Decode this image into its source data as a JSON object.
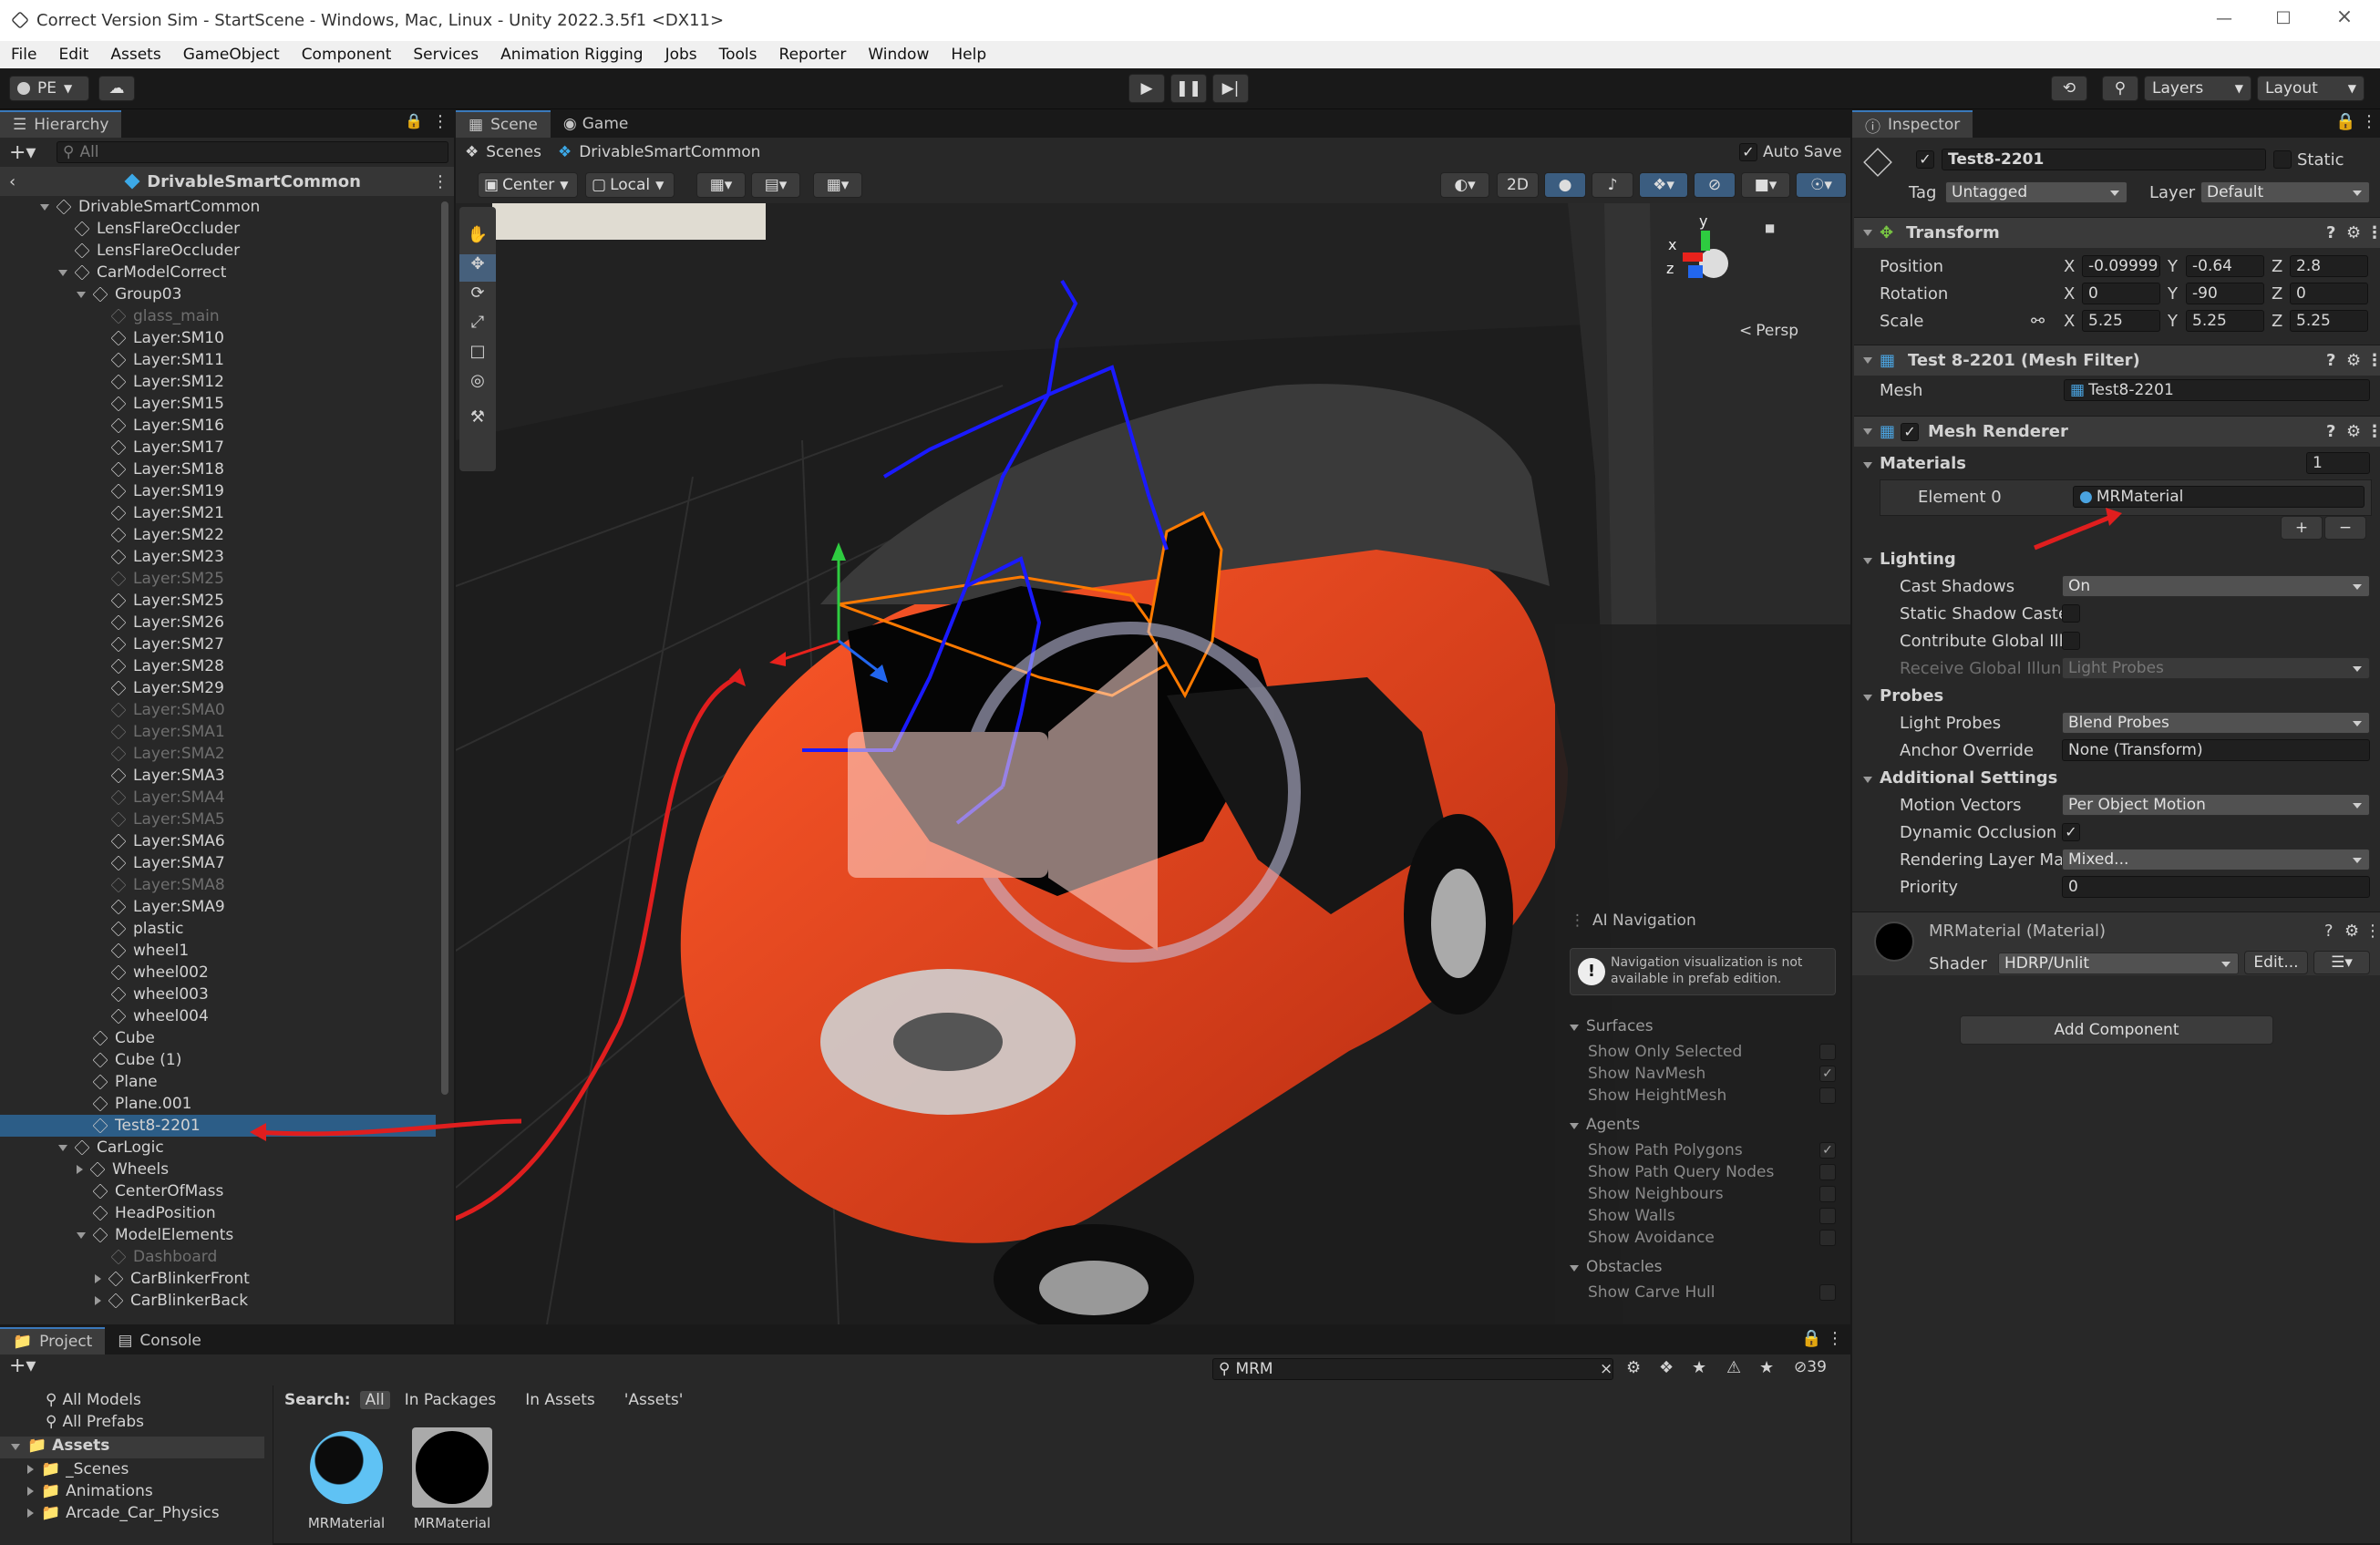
{
  "window": {
    "title": "Correct Version Sim - StartScene - Windows, Mac, Linux - Unity 2022.3.5f1 <DX11>"
  },
  "menu": [
    "File",
    "Edit",
    "Assets",
    "GameObject",
    "Component",
    "Services",
    "Animation Rigging",
    "Jobs",
    "Tools",
    "Reporter",
    "Window",
    "Help"
  ],
  "toolbar": {
    "account": "PE",
    "layers": "Layers",
    "layout": "Layout"
  },
  "hierarchy": {
    "tab": "Hierarchy",
    "search_placeholder": "All",
    "scene": "DrivableSmartCommon",
    "rows": [
      {
        "label": "DrivableSmartCommon",
        "indent": 1,
        "exp": "d",
        "dim": false
      },
      {
        "label": "LensFlareOccluder",
        "indent": 2,
        "exp": "",
        "dim": false
      },
      {
        "label": "LensFlareOccluder",
        "indent": 2,
        "exp": "",
        "dim": false
      },
      {
        "label": "CarModelCorrect",
        "indent": 2,
        "exp": "d",
        "dim": false
      },
      {
        "label": "Group03",
        "indent": 3,
        "exp": "d",
        "dim": false
      },
      {
        "label": "glass_main",
        "indent": 4,
        "exp": "",
        "dim": true
      },
      {
        "label": "Layer:SM10",
        "indent": 4,
        "exp": "",
        "dim": false
      },
      {
        "label": "Layer:SM11",
        "indent": 4,
        "exp": "",
        "dim": false
      },
      {
        "label": "Layer:SM12",
        "indent": 4,
        "exp": "",
        "dim": false
      },
      {
        "label": "Layer:SM15",
        "indent": 4,
        "exp": "",
        "dim": false
      },
      {
        "label": "Layer:SM16",
        "indent": 4,
        "exp": "",
        "dim": false
      },
      {
        "label": "Layer:SM17",
        "indent": 4,
        "exp": "",
        "dim": false
      },
      {
        "label": "Layer:SM18",
        "indent": 4,
        "exp": "",
        "dim": false
      },
      {
        "label": "Layer:SM19",
        "indent": 4,
        "exp": "",
        "dim": false
      },
      {
        "label": "Layer:SM21",
        "indent": 4,
        "exp": "",
        "dim": false
      },
      {
        "label": "Layer:SM22",
        "indent": 4,
        "exp": "",
        "dim": false
      },
      {
        "label": "Layer:SM23",
        "indent": 4,
        "exp": "",
        "dim": false
      },
      {
        "label": "Layer:SM25",
        "indent": 4,
        "exp": "",
        "dim": true
      },
      {
        "label": "Layer:SM25",
        "indent": 4,
        "exp": "",
        "dim": false
      },
      {
        "label": "Layer:SM26",
        "indent": 4,
        "exp": "",
        "dim": false
      },
      {
        "label": "Layer:SM27",
        "indent": 4,
        "exp": "",
        "dim": false
      },
      {
        "label": "Layer:SM28",
        "indent": 4,
        "exp": "",
        "dim": false
      },
      {
        "label": "Layer:SM29",
        "indent": 4,
        "exp": "",
        "dim": false
      },
      {
        "label": "Layer:SMA0",
        "indent": 4,
        "exp": "",
        "dim": true
      },
      {
        "label": "Layer:SMA1",
        "indent": 4,
        "exp": "",
        "dim": true
      },
      {
        "label": "Layer:SMA2",
        "indent": 4,
        "exp": "",
        "dim": true
      },
      {
        "label": "Layer:SMA3",
        "indent": 4,
        "exp": "",
        "dim": false
      },
      {
        "label": "Layer:SMA4",
        "indent": 4,
        "exp": "",
        "dim": true
      },
      {
        "label": "Layer:SMA5",
        "indent": 4,
        "exp": "",
        "dim": true
      },
      {
        "label": "Layer:SMA6",
        "indent": 4,
        "exp": "",
        "dim": false
      },
      {
        "label": "Layer:SMA7",
        "indent": 4,
        "exp": "",
        "dim": false
      },
      {
        "label": "Layer:SMA8",
        "indent": 4,
        "exp": "",
        "dim": true
      },
      {
        "label": "Layer:SMA9",
        "indent": 4,
        "exp": "",
        "dim": false
      },
      {
        "label": "plastic",
        "indent": 4,
        "exp": "",
        "dim": false
      },
      {
        "label": "wheel1",
        "indent": 4,
        "exp": "",
        "dim": false
      },
      {
        "label": "wheel002",
        "indent": 4,
        "exp": "",
        "dim": false
      },
      {
        "label": "wheel003",
        "indent": 4,
        "exp": "",
        "dim": false
      },
      {
        "label": "wheel004",
        "indent": 4,
        "exp": "",
        "dim": false
      },
      {
        "label": "Cube",
        "indent": 3,
        "exp": "",
        "dim": false
      },
      {
        "label": "Cube (1)",
        "indent": 3,
        "exp": "",
        "dim": false
      },
      {
        "label": "Plane",
        "indent": 3,
        "exp": "",
        "dim": false
      },
      {
        "label": "Plane.001",
        "indent": 3,
        "exp": "",
        "dim": false
      },
      {
        "label": "Test8-2201",
        "indent": 3,
        "exp": "",
        "dim": false,
        "sel": true
      },
      {
        "label": "CarLogic",
        "indent": 2,
        "exp": "d",
        "dim": false
      },
      {
        "label": "Wheels",
        "indent": 3,
        "exp": "r",
        "dim": false
      },
      {
        "label": "CenterOfMass",
        "indent": 3,
        "exp": "",
        "dim": false
      },
      {
        "label": "HeadPosition",
        "indent": 3,
        "exp": "",
        "dim": false
      },
      {
        "label": "ModelElements",
        "indent": 3,
        "exp": "d",
        "dim": false
      },
      {
        "label": "Dashboard",
        "indent": 4,
        "exp": "",
        "dim": true
      },
      {
        "label": "CarBlinkerFront",
        "indent": 4,
        "exp": "r",
        "dim": false
      },
      {
        "label": "CarBlinkerBack",
        "indent": 4,
        "exp": "r",
        "dim": false
      }
    ]
  },
  "scene": {
    "tab_scene": "Scene",
    "tab_game": "Game",
    "breadcrumb_root": "Scenes",
    "breadcrumb_prefab": "DrivableSmartCommon",
    "auto_save": "Auto Save",
    "pivot": "Center",
    "space": "Local",
    "mode_2d": "2D",
    "persp": "Persp",
    "gizmo_axes": {
      "y": "y",
      "x": "x",
      "z": "z"
    }
  },
  "ai_nav": {
    "title": "AI Navigation",
    "notice": "Navigation visualization is not available in prefab edition.",
    "surfaces": "Surfaces",
    "surface_items": [
      {
        "label": "Show Only Selected",
        "checked": false
      },
      {
        "label": "Show NavMesh",
        "checked": true
      },
      {
        "label": "Show HeightMesh",
        "checked": false
      }
    ],
    "agents": "Agents",
    "agent_items": [
      {
        "label": "Show Path Polygons",
        "checked": true
      },
      {
        "label": "Show Path Query Nodes",
        "checked": false
      },
      {
        "label": "Show Neighbours",
        "checked": false
      },
      {
        "label": "Show Walls",
        "checked": false
      },
      {
        "label": "Show Avoidance",
        "checked": false
      }
    ],
    "obstacles": "Obstacles",
    "obstacle_items": [
      {
        "label": "Show Carve Hull",
        "checked": false
      }
    ]
  },
  "inspector": {
    "tab": "Inspector",
    "object_name": "Test8-2201",
    "static": "Static",
    "tag_label": "Tag",
    "tag": "Untagged",
    "layer_label": "Layer",
    "layer": "Default",
    "transform": {
      "title": "Transform",
      "position": {
        "label": "Position",
        "x": "-0.09999",
        "y": "-0.64",
        "z": "2.8"
      },
      "rotation": {
        "label": "Rotation",
        "x": "0",
        "y": "-90",
        "z": "0"
      },
      "scale": {
        "label": "Scale",
        "x": "5.25",
        "y": "5.25",
        "z": "5.25"
      }
    },
    "mesh_filter": {
      "title": "Test 8-2201 (Mesh Filter)",
      "mesh_label": "Mesh",
      "mesh": "Test8-2201"
    },
    "mesh_renderer": {
      "title": "Mesh Renderer",
      "materials_label": "Materials",
      "materials_count": "1",
      "element_label": "Element 0",
      "element_value": "MRMaterial",
      "lighting": "Lighting",
      "cast_shadows_label": "Cast Shadows",
      "cast_shadows": "On",
      "static_shadow_label": "Static Shadow Caste",
      "contribute_gi_label": "Contribute Global Ill",
      "receive_gi_label": "Receive Global Illun",
      "receive_gi": "Light Probes",
      "probes": "Probes",
      "light_probes_label": "Light Probes",
      "light_probes": "Blend Probes",
      "anchor_label": "Anchor Override",
      "anchor": "None (Transform)",
      "additional": "Additional Settings",
      "motion_label": "Motion Vectors",
      "motion": "Per Object Motion",
      "dyn_occ_label": "Dynamic Occlusion",
      "render_layer_label": "Rendering Layer Ma",
      "render_layer": "Mixed...",
      "priority_label": "Priority",
      "priority": "0"
    },
    "material": {
      "title": "MRMaterial (Material)",
      "shader_label": "Shader",
      "shader": "HDRP/Unlit",
      "edit": "Edit..."
    },
    "add_component": "Add Component"
  },
  "project": {
    "tab_project": "Project",
    "tab_console": "Console",
    "favorites": [
      "All Models",
      "All Prefabs"
    ],
    "assets_root": "Assets",
    "folders": [
      "_Scenes",
      "Animations",
      "Arcade_Car_Physics"
    ],
    "search_value": "MRM",
    "search_label": "Search:",
    "scopes": [
      "All",
      "In Packages",
      "In Assets",
      "'Assets'"
    ],
    "hidden_count": "39",
    "items": [
      {
        "label": "MRMaterial",
        "kind": "blue"
      },
      {
        "label": "MRMaterial",
        "kind": "black"
      }
    ]
  },
  "colors": {
    "accent": "#3a79bb",
    "selection": "#2c5d87",
    "car": "#e8401c",
    "skeleton": "#1a1aff",
    "annotation": "#e01e1e"
  }
}
